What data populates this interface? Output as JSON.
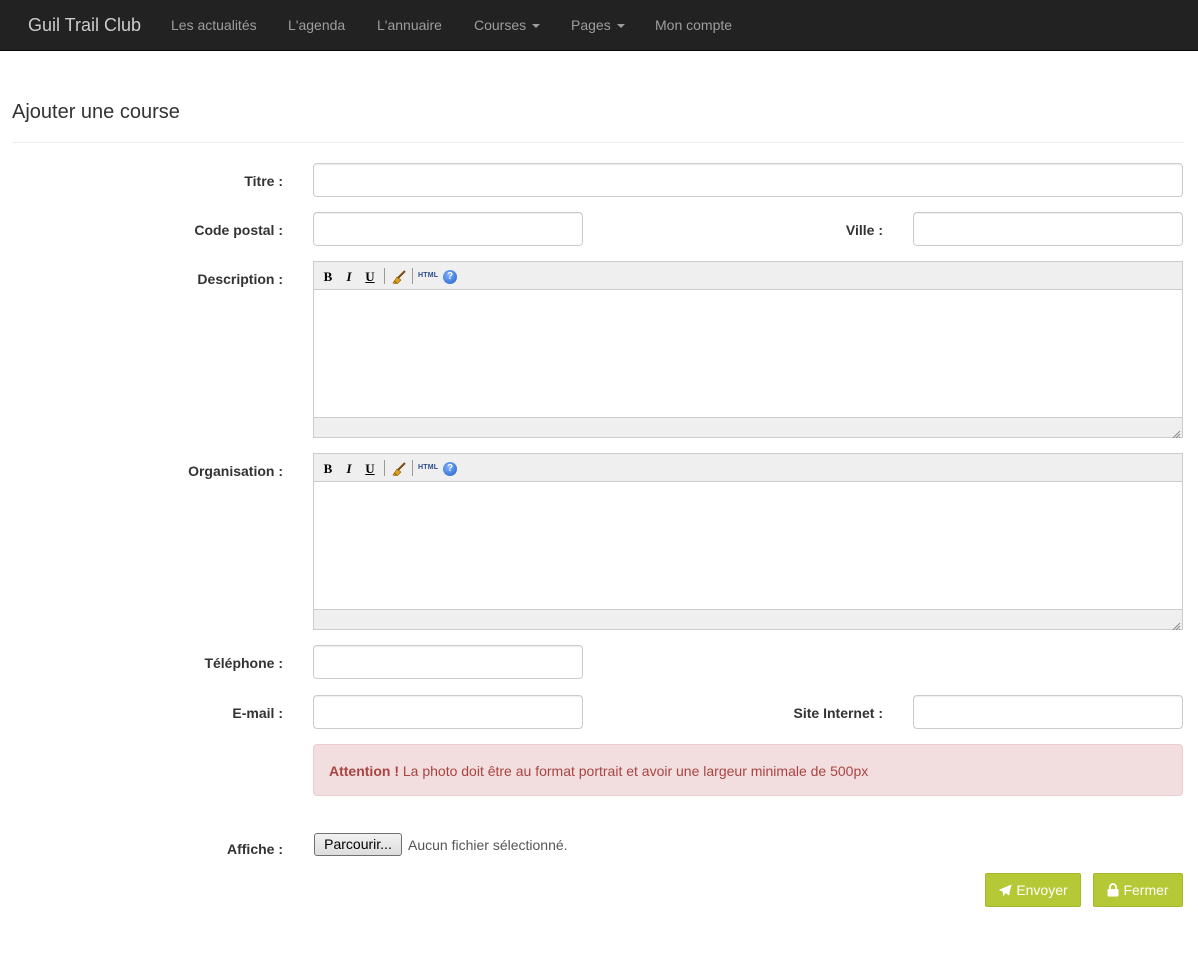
{
  "navbar": {
    "brand": "Guil Trail Club",
    "items": [
      {
        "label": "Les actualités",
        "dropdown": false
      },
      {
        "label": "L'agenda",
        "dropdown": false
      },
      {
        "label": "L'annuaire",
        "dropdown": false
      },
      {
        "label": "Courses",
        "dropdown": true
      },
      {
        "label": "Pages",
        "dropdown": true
      },
      {
        "label": "Mon compte",
        "dropdown": false
      }
    ]
  },
  "page": {
    "title": "Ajouter une course"
  },
  "form": {
    "titre_label": "Titre :",
    "titre_value": "",
    "code_postal_label": "Code postal :",
    "code_postal_value": "",
    "ville_label": "Ville :",
    "ville_value": "",
    "description_label": "Description :",
    "organisation_label": "Organisation :",
    "editor_toolbar": {
      "bold": "B",
      "italic": "I",
      "underline": "U",
      "html": "HTML",
      "help": "?",
      "icons": [
        "bold-icon",
        "italic-icon",
        "underline-icon",
        "broom-icon",
        "html-icon",
        "help-icon"
      ]
    },
    "telephone_label": "Téléphone :",
    "telephone_value": "",
    "email_label": "E-mail :",
    "email_value": "",
    "site_label": "Site Internet :",
    "site_value": "",
    "alert": {
      "strong": "Attention !",
      "text": "La photo doit être au format portrait et avoir une largeur minimale de 500px"
    },
    "affiche_label": "Affiche :",
    "file_button": "Parcourir...",
    "file_status": "Aucun fichier sélectionné."
  },
  "actions": {
    "envoyer": "Envoyer",
    "fermer": "Fermer"
  },
  "colors": {
    "navbar_bg": "#222222",
    "accent_green": "#b5c835",
    "alert_bg": "#f2dede",
    "alert_text": "#a94442"
  }
}
